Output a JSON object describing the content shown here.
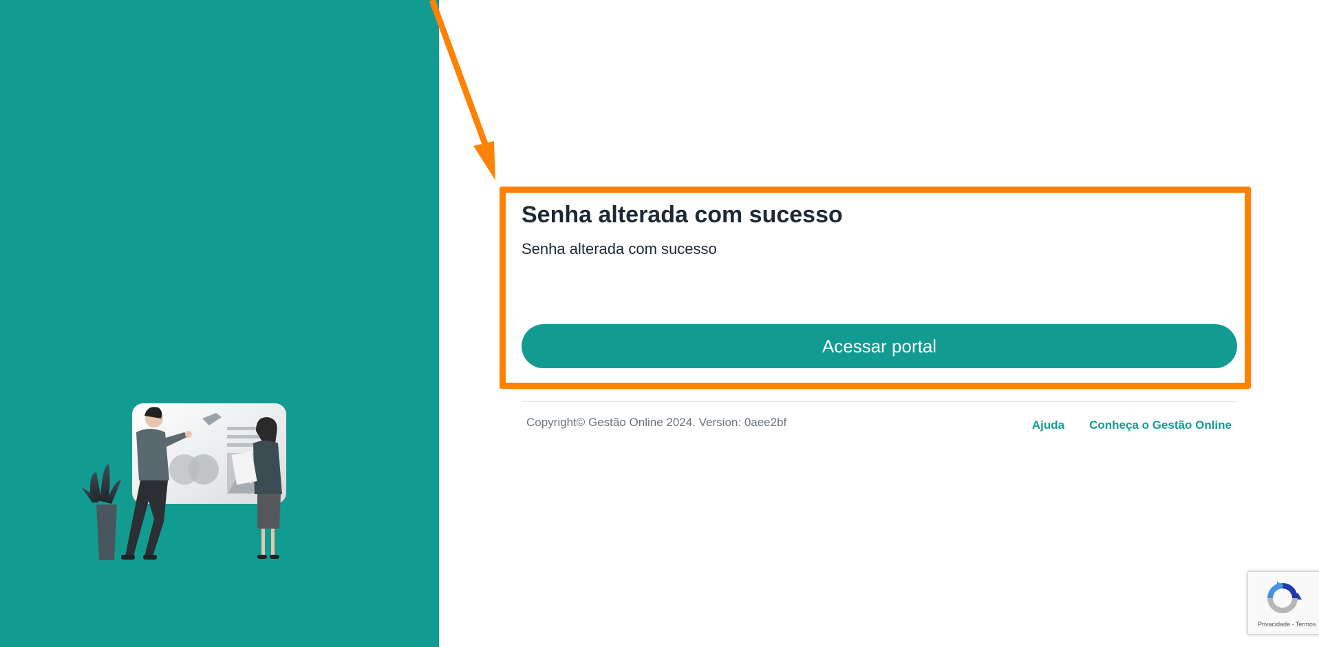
{
  "card": {
    "title": "Senha alterada com sucesso",
    "message": "Senha alterada com sucesso",
    "button_label": "Acessar portal"
  },
  "footer": {
    "copyright": "Copyright© Gestão Online 2024. Version: 0aee2bf",
    "links": [
      {
        "label": "Ajuda"
      },
      {
        "label": "Conheça o Gestão Online"
      }
    ]
  },
  "recaptcha": {
    "privacy_label": "Privacidade",
    "separator": " - ",
    "terms_label": "Termos"
  },
  "colors": {
    "brand_teal": "#129c91",
    "annotation_orange": "#ff8205",
    "heading_text": "#1d2a36"
  },
  "icons": {
    "illustration": "team-presentation-illustration",
    "annotation": "arrow-annotation",
    "recaptcha": "recaptcha-icon"
  }
}
